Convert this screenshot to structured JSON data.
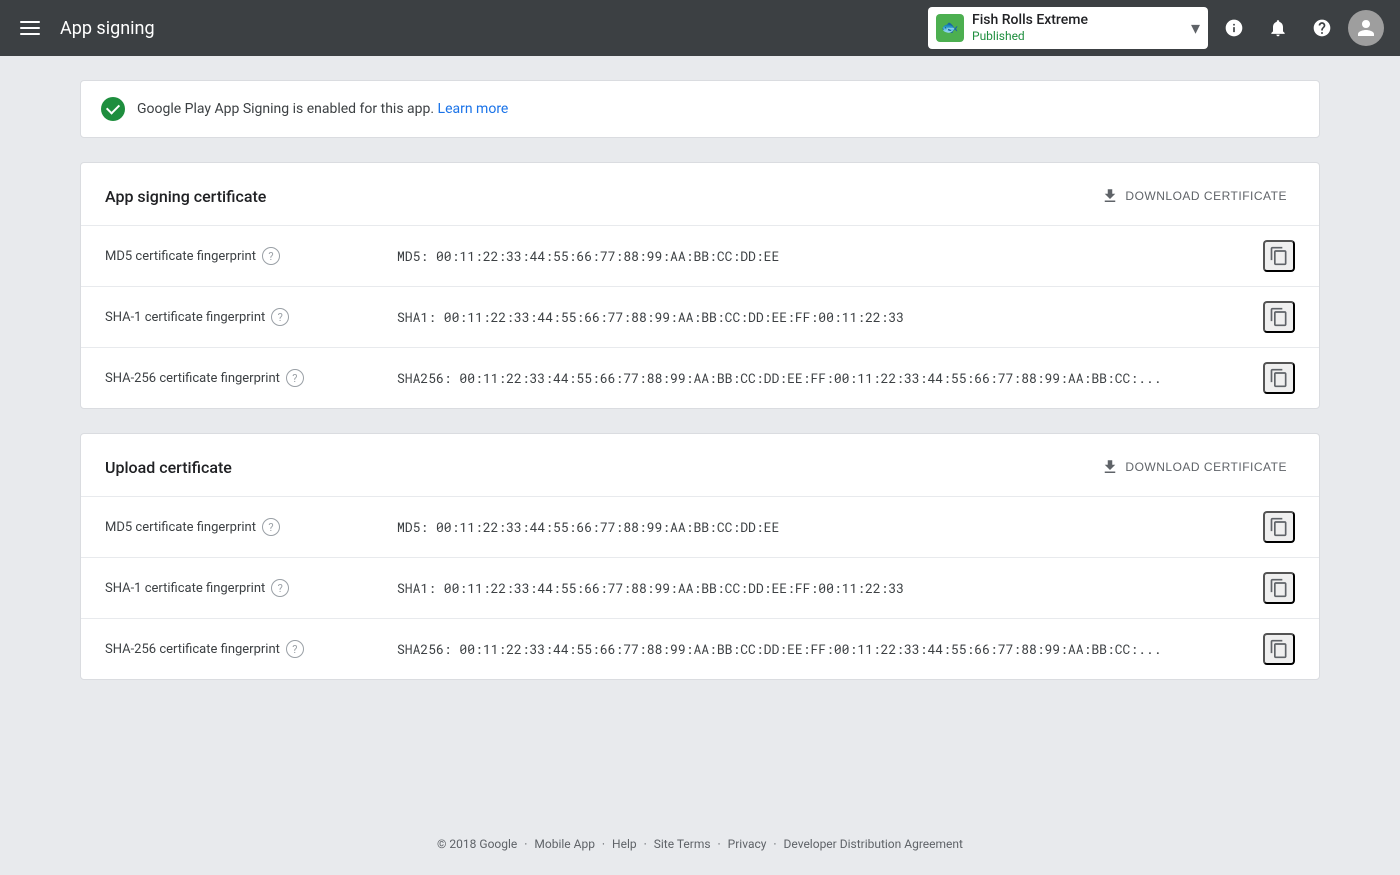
{
  "header": {
    "menu_label": "Menu",
    "title": "App signing",
    "app": {
      "name": "Fish Rolls Extreme",
      "status": "Published",
      "icon_symbol": "🐟"
    },
    "icons": {
      "info": "ℹ",
      "bell": "🔔",
      "help": "?",
      "avatar": "👤"
    }
  },
  "notice": {
    "text": "Google Play App Signing is enabled for this app.",
    "link_text": "Learn more",
    "link_href": "#"
  },
  "app_signing": {
    "title": "App signing certificate",
    "download_btn": "DOWNLOAD CERTIFICATE",
    "rows": [
      {
        "label": "MD5 certificate fingerprint",
        "value": "MD5: 00:11:22:33:44:55:66:77:88:99:AA:BB:CC:DD:EE"
      },
      {
        "label": "SHA-1 certificate fingerprint",
        "value": "SHA1: 00:11:22:33:44:55:66:77:88:99:AA:BB:CC:DD:EE:FF:00:11:22:33"
      },
      {
        "label": "SHA-256 certificate fingerprint",
        "value": "SHA256: 00:11:22:33:44:55:66:77:88:99:AA:BB:CC:DD:EE:FF:00:11:22:33:44:55:66:77:88:99:AA:BB:CC:..."
      }
    ]
  },
  "upload_cert": {
    "title": "Upload certificate",
    "download_btn": "DOWNLOAD CERTIFICATE",
    "rows": [
      {
        "label": "MD5 certificate fingerprint",
        "value": "MD5: 00:11:22:33:44:55:66:77:88:99:AA:BB:CC:DD:EE"
      },
      {
        "label": "SHA-1 certificate fingerprint",
        "value": "SHA1: 00:11:22:33:44:55:66:77:88:99:AA:BB:CC:DD:EE:FF:00:11:22:33"
      },
      {
        "label": "SHA-256 certificate fingerprint",
        "value": "SHA256: 00:11:22:33:44:55:66:77:88:99:AA:BB:CC:DD:EE:FF:00:11:22:33:44:55:66:77:88:99:AA:BB:CC:..."
      }
    ]
  },
  "footer": {
    "copyright": "© 2018 Google",
    "links": [
      "Mobile App",
      "Help",
      "Site Terms",
      "Privacy",
      "Developer Distribution Agreement"
    ],
    "separator": "·"
  }
}
